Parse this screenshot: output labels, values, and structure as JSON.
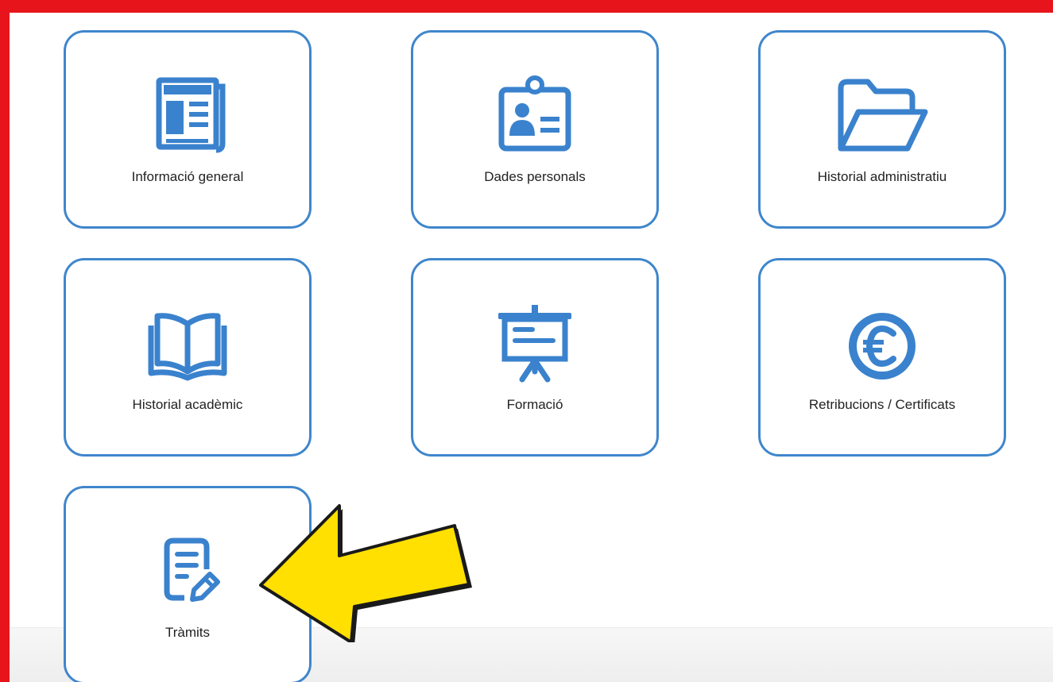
{
  "tiles": [
    {
      "label": "Informació general",
      "icon": "newspaper-icon"
    },
    {
      "label": "Dades personals",
      "icon": "id-badge-icon"
    },
    {
      "label": "Historial administratiu",
      "icon": "folder-open-icon"
    },
    {
      "label": "Historial acadèmic",
      "icon": "open-book-icon"
    },
    {
      "label": "Formació",
      "icon": "presentation-board-icon"
    },
    {
      "label": "Retribucions / Certificats",
      "icon": "euro-coin-icon"
    },
    {
      "label": "Tràmits",
      "icon": "document-edit-icon"
    }
  ],
  "colors": {
    "frame": "#e8141b",
    "accent": "#3f86cc",
    "icon": "#3a82cd",
    "arrow": "#ffe000"
  }
}
